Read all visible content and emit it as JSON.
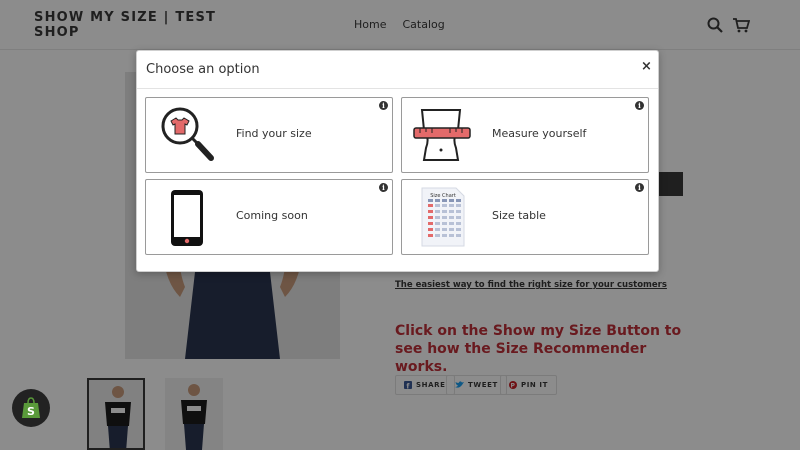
{
  "header": {
    "logo": "SHOW MY SIZE | TEST SHOP",
    "nav": [
      "Home",
      "Catalog"
    ],
    "search_icon": "search-icon",
    "cart_icon": "cart-icon"
  },
  "product": {
    "link_text": "The easiest way to find the right size for your customers",
    "promo_prefix": "Click on the ",
    "promo_bold": "Show my Size Button",
    "promo_suffix": " to see how the Size Recommender works.",
    "share": {
      "facebook": "SHARE",
      "twitter": "TWEET",
      "pinterest": "PIN IT"
    }
  },
  "modal": {
    "title": "Choose an option",
    "close": "×",
    "info_glyph": "i",
    "options": [
      {
        "label": "Find your size",
        "icon": "search-shirt-icon"
      },
      {
        "label": "Measure yourself",
        "icon": "measuring-tape-icon"
      },
      {
        "label": "Coming soon",
        "icon": "smartphone-icon"
      },
      {
        "label": "Size table",
        "icon": "size-chart-icon",
        "chart_caption": "Size Chart"
      }
    ]
  },
  "colors": {
    "promo": "#c0303a",
    "tape": "#e36a6a",
    "dark": "#3a3a3a"
  }
}
